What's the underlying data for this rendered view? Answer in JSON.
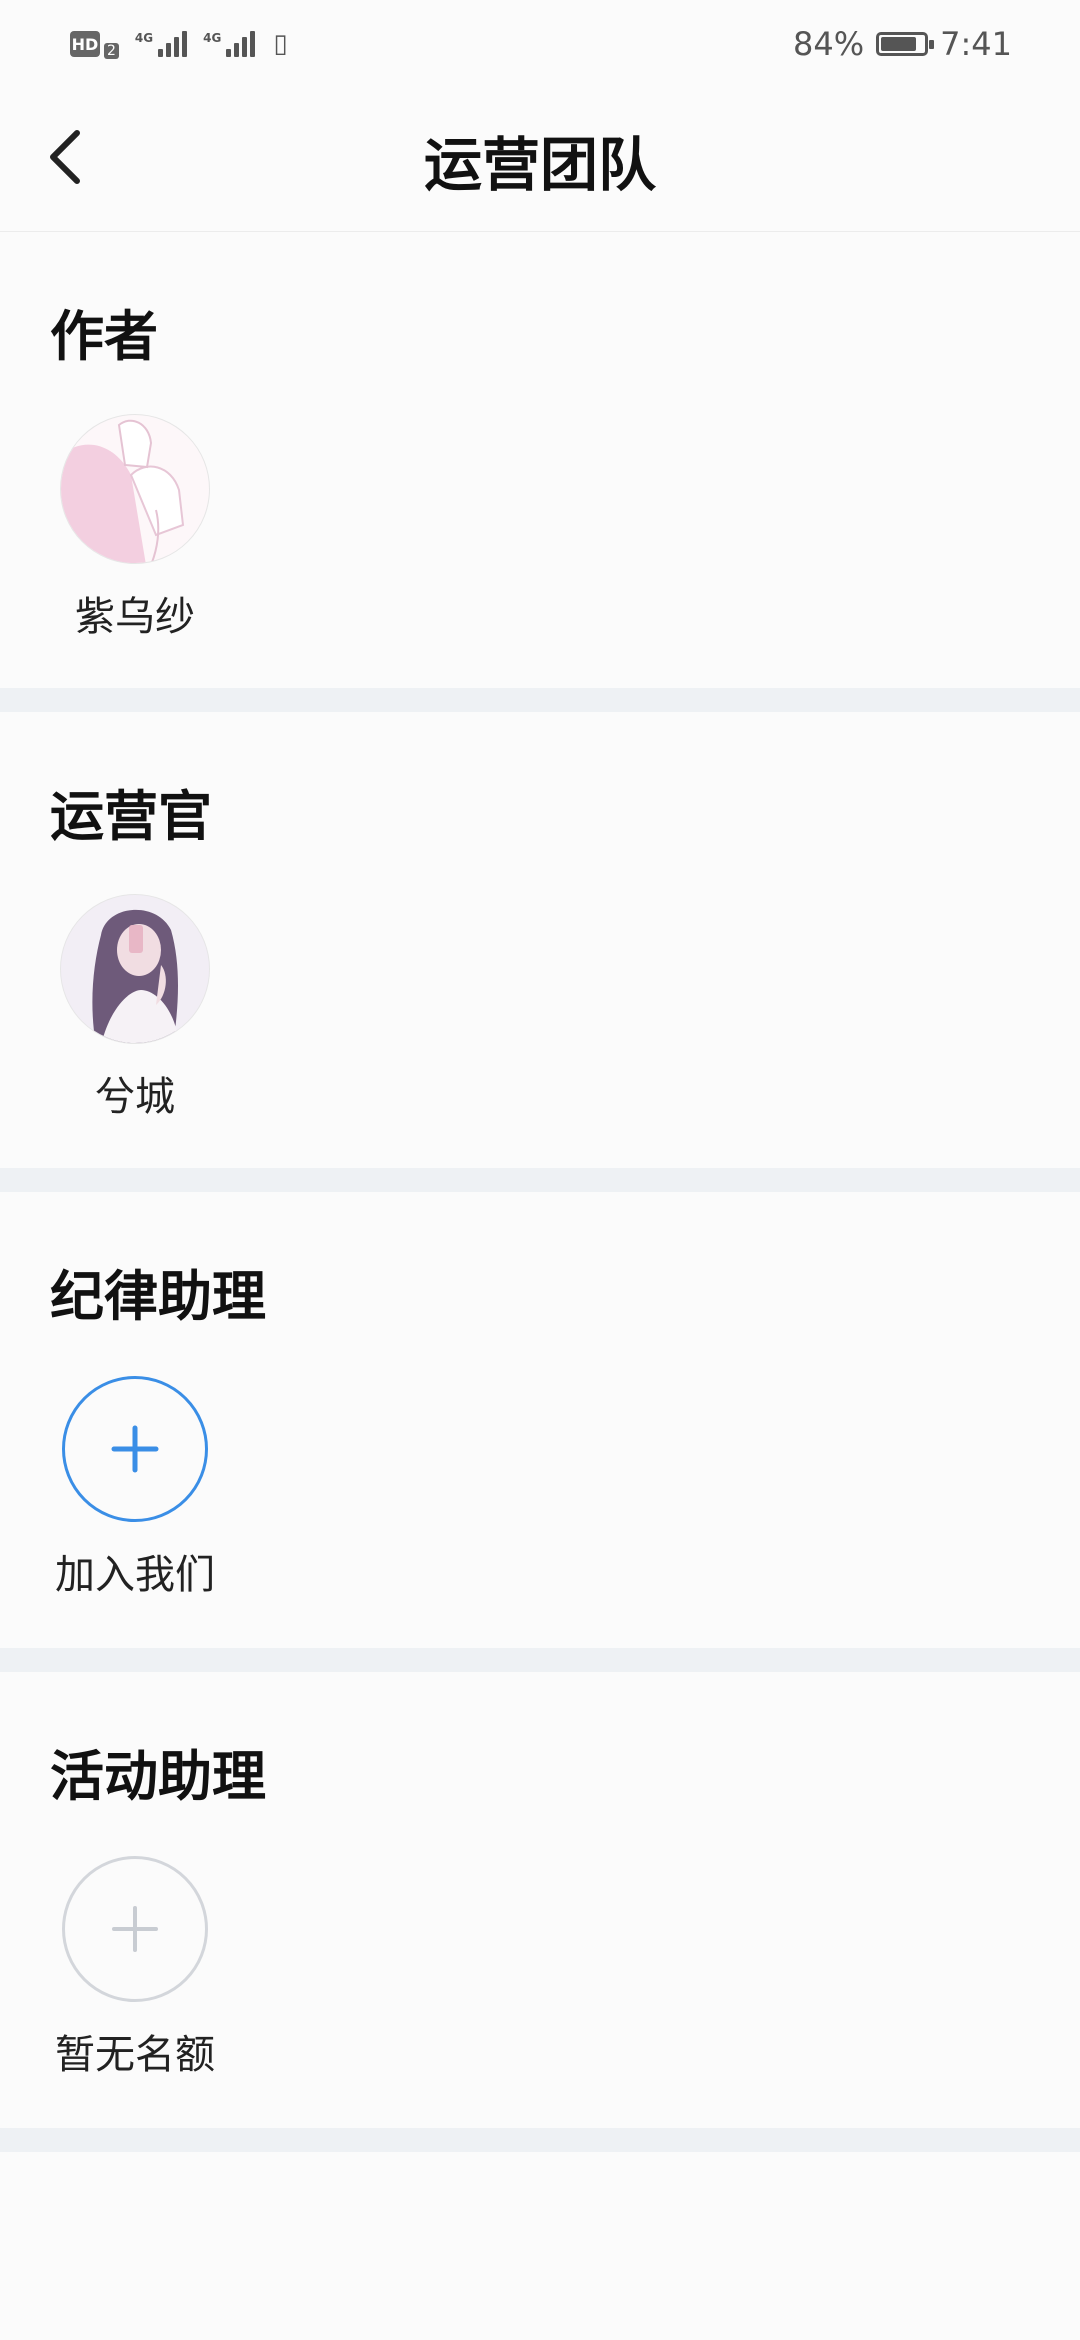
{
  "status_bar": {
    "hd": "HD",
    "sim": "2",
    "net1": "4G",
    "net2": "4G",
    "battery_percent_text": "84%",
    "battery_level": 0.84,
    "time": "7:41"
  },
  "header": {
    "title": "运营团队",
    "back_icon": "chevron-left-icon"
  },
  "sections": [
    {
      "title": "作者",
      "members": [
        {
          "name": "紫乌纱",
          "avatar": "pink-illustration-avatar"
        }
      ]
    },
    {
      "title": "运营官",
      "members": [
        {
          "name": "兮城",
          "avatar": "girl-photo-avatar"
        }
      ]
    },
    {
      "title": "纪律助理",
      "action": {
        "label": "加入我们",
        "icon": "plus-icon",
        "color": "#3a8ee6"
      }
    },
    {
      "title": "活动助理",
      "action": {
        "label": "暂无名额",
        "icon": "plus-icon",
        "color": "#c8ccd2"
      }
    }
  ]
}
